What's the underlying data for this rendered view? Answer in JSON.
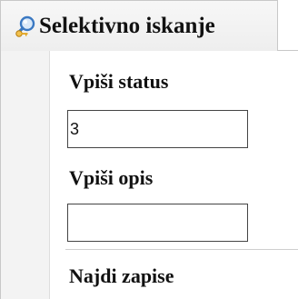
{
  "header": {
    "title": "Selektivno iskanje",
    "icon": "search-key-icon"
  },
  "status_field": {
    "label": "Vpiši status",
    "value": "3"
  },
  "description_field": {
    "label": "Vpiši opis",
    "value": ""
  },
  "actions": {
    "find_records_label": "Najdi zapise"
  },
  "colors": {
    "text": "#111111",
    "border": "#c8c8c8",
    "gutter": "#f3f3f3",
    "icon_blue": "#3a78c2",
    "icon_gold": "#e0a21a"
  }
}
